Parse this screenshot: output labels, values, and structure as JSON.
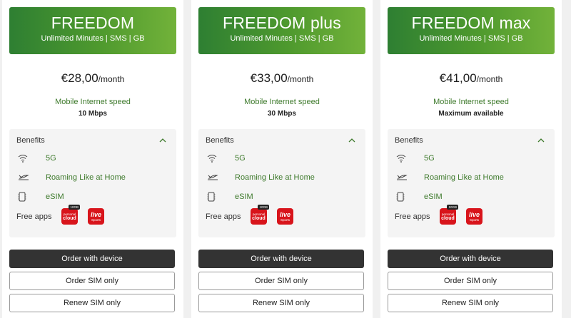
{
  "colors": {
    "accent_start": "#2e7f32",
    "accent_end": "#72b23a",
    "primary_button": "#333333",
    "text_green": "#3e7a2c",
    "app_red": "#d8141b"
  },
  "plans": [
    {
      "name": "FREEDOM",
      "subtitle": "Unlimited Minutes | SMS | GB",
      "price": "€28,00",
      "per": "/month",
      "speed_label": "Mobile Internet speed",
      "speed_value": "10 Mbps",
      "benefits_title": "Benefits",
      "benefits": [
        "5G",
        "Roaming Like at Home",
        "eSIM"
      ],
      "free_apps_label": "Free apps",
      "apps": {
        "cloud_badge": "10GB",
        "cloud_line1": "personal",
        "cloud_line2": "cloud",
        "live_line1": "live",
        "live_line2": "Sports"
      },
      "order_device": "Order with device",
      "order_sim": "Order SIM only",
      "renew_sim": "Renew SIM only"
    },
    {
      "name": "FREEDOM plus",
      "subtitle": "Unlimited Minutes | SMS | GB",
      "price": "€33,00",
      "per": "/month",
      "speed_label": "Mobile Internet speed",
      "speed_value": "30 Mbps",
      "benefits_title": "Benefits",
      "benefits": [
        "5G",
        "Roaming Like at Home",
        "eSIM"
      ],
      "free_apps_label": "Free apps",
      "apps": {
        "cloud_badge": "10GB",
        "cloud_line1": "personal",
        "cloud_line2": "cloud",
        "live_line1": "live",
        "live_line2": "Sports"
      },
      "order_device": "Order with device",
      "order_sim": "Order SIM only",
      "renew_sim": "Renew SIM only"
    },
    {
      "name": "FREEDOM max",
      "subtitle": "Unlimited Minutes | SMS | GB",
      "price": "€41,00",
      "per": "/month",
      "speed_label": "Mobile Internet speed",
      "speed_value": "Maximum available",
      "benefits_title": "Benefits",
      "benefits": [
        "5G",
        "Roaming Like at Home",
        "eSIM"
      ],
      "free_apps_label": "Free apps",
      "apps": {
        "cloud_badge": "10GB",
        "cloud_line1": "personal",
        "cloud_line2": "cloud",
        "live_line1": "live",
        "live_line2": "Sports"
      },
      "order_device": "Order with device",
      "order_sim": "Order SIM only",
      "renew_sim": "Renew SIM only"
    }
  ],
  "icons": [
    "wifi-icon",
    "roaming-plane-icon",
    "esim-icon",
    "chevron-up-icon",
    "personal-cloud-app-icon",
    "live-sports-app-icon"
  ]
}
